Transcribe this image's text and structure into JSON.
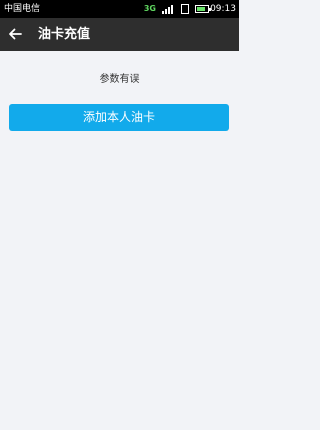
{
  "status_bar": {
    "carrier": "中国电信",
    "network": "3G",
    "time": "09:13",
    "battery_level": 0.75
  },
  "app_bar": {
    "title": "油卡充值",
    "back_icon": "arrow-left-icon"
  },
  "main": {
    "error_message": "参数有误",
    "add_card_button_label": "添加本人油卡"
  },
  "colors": {
    "accent": "#12aaeb",
    "app_bar_bg": "#2e2e2e",
    "page_bg": "#f2f3f7"
  }
}
